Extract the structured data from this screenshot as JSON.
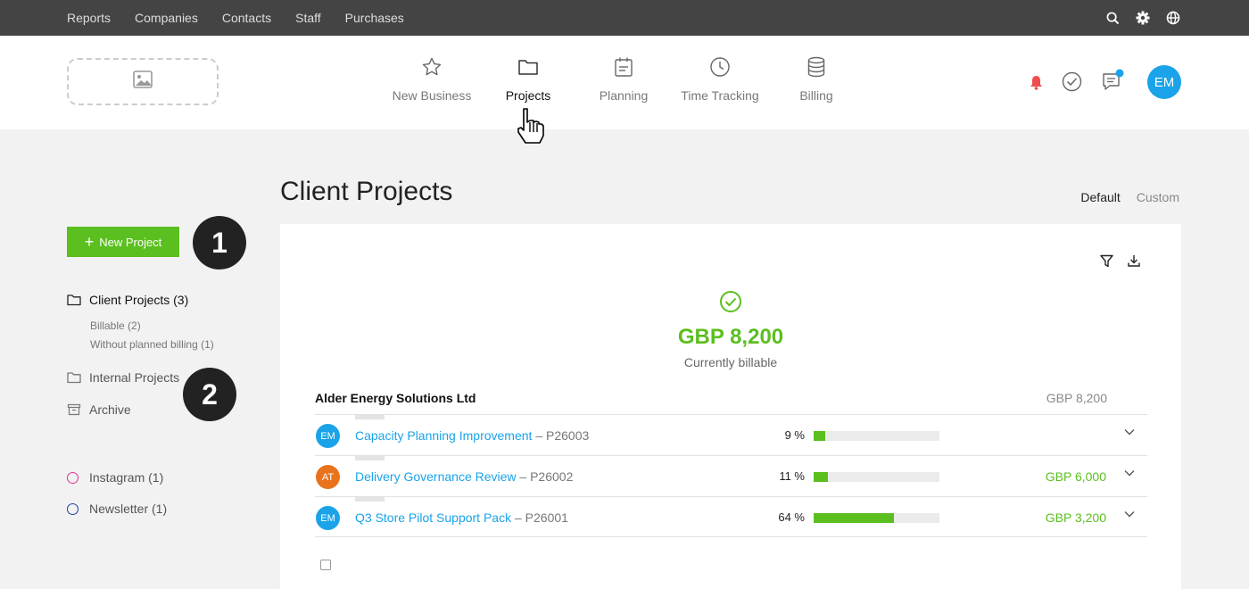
{
  "topbar": {
    "menu": [
      "Reports",
      "Companies",
      "Contacts",
      "Staff",
      "Purchases"
    ],
    "icons": [
      "search-icon",
      "gear-icon",
      "globe-icon"
    ]
  },
  "header": {
    "logo_icon": "image-placeholder-icon",
    "nav": [
      {
        "label": "New Business",
        "icon": "star-icon",
        "active": false
      },
      {
        "label": "Projects",
        "icon": "folder-icon",
        "active": true
      },
      {
        "label": "Planning",
        "icon": "calendar-icon",
        "active": false
      },
      {
        "label": "Time Tracking",
        "icon": "clock-icon",
        "active": false
      },
      {
        "label": "Billing",
        "icon": "database-icon",
        "active": false
      }
    ],
    "user_initials": "EM",
    "colors": {
      "bell": "#f04e4e",
      "chat_dot": "#1aa3e8",
      "avatar": "#1aa3e8"
    }
  },
  "sidebar": {
    "new_project_label": "New Project",
    "steps": [
      "1",
      "2"
    ],
    "folders": [
      {
        "label": "Client Projects (3)",
        "icon": "folder-icon",
        "active": true
      },
      {
        "label": "Internal Projects",
        "icon": "folder-icon",
        "active": false
      },
      {
        "label": "Archive",
        "icon": "archive-icon",
        "active": false
      }
    ],
    "subitems": [
      "Billable (2)",
      "Without planned billing (1)"
    ],
    "tags": [
      {
        "label": "Instagram (1)",
        "color": "#e0339a"
      },
      {
        "label": "Newsletter (1)",
        "color": "#1b3fa8"
      }
    ]
  },
  "main": {
    "title": "Client Projects",
    "views": [
      "Default",
      "Custom"
    ],
    "card_icons": [
      "filter-icon",
      "download-icon"
    ],
    "summary": {
      "amount": "GBP 8,200",
      "caption": "Currently billable"
    },
    "client": {
      "name": "Alder Energy Solutions Ltd",
      "total": "GBP 8,200"
    },
    "projects": [
      {
        "initials": "EM",
        "avatar_color": "#1aa3e8",
        "name": "Capacity Planning Improvement",
        "code": "– P26003",
        "percent_label": "9 %",
        "percent": 9,
        "amount": ""
      },
      {
        "initials": "AT",
        "avatar_color": "#e8731a",
        "name": "Delivery Governance Review",
        "code": "– P26002",
        "percent_label": "11 %",
        "percent": 11,
        "amount": "GBP 6,000"
      },
      {
        "initials": "EM",
        "avatar_color": "#1aa3e8",
        "name": "Q3 Store Pilot Support Pack",
        "code": "– P26001",
        "percent_label": "64 %",
        "percent": 64,
        "amount": "GBP 3,200"
      }
    ],
    "accent": "#5bbf1f",
    "link_color": "#1aa3e8"
  }
}
